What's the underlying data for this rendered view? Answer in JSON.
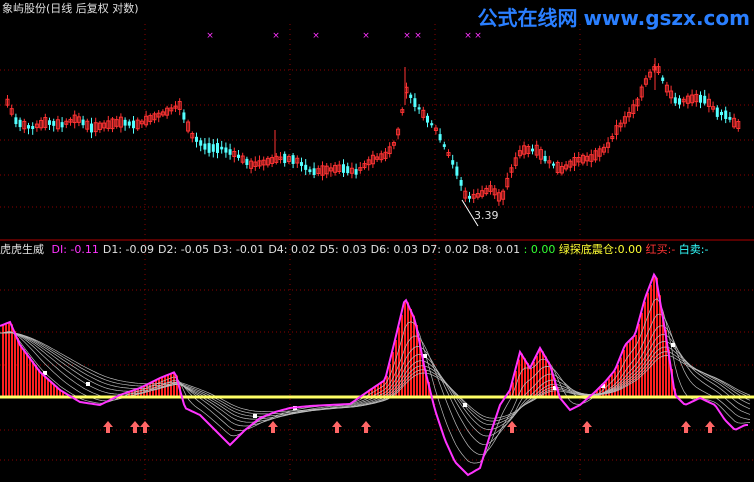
{
  "header": {
    "title": "象屿股份(日线 后复权 对数)",
    "watermark_cn": "公式在线网",
    "watermark_url": "www.gszx.com"
  },
  "indicator": {
    "name": "虎虎生威",
    "items": [
      {
        "label": "DI:",
        "value": "-0.11",
        "color": "#ff33ff"
      },
      {
        "label": "D1:",
        "value": "-0.09",
        "color": "#e0e0e0"
      },
      {
        "label": "D2:",
        "value": "-0.05",
        "color": "#e0e0e0"
      },
      {
        "label": "D3:",
        "value": "-0.01",
        "color": "#e0e0e0"
      },
      {
        "label": "D4:",
        "value": "0.02",
        "color": "#e0e0e0"
      },
      {
        "label": "D5:",
        "value": "0.03",
        "color": "#e0e0e0"
      },
      {
        "label": "D6:",
        "value": "0.03",
        "color": "#e0e0e0"
      },
      {
        "label": "D7:",
        "value": "0.02",
        "color": "#e0e0e0"
      },
      {
        "label": "D8:",
        "value": "0.01",
        "color": "#e0e0e0"
      }
    ],
    "zero_value": ": 0.00",
    "signal_label": "绿探底震仓:",
    "signal_value": "0.00",
    "buy_label": "红买:",
    "buy_value": "-",
    "sell_label": "白卖:",
    "sell_value": "-"
  },
  "price_chart": {
    "low_label": "3.39",
    "colors": {
      "up": "#ff3333",
      "down": "#54ffff",
      "marker": "#ff33ff",
      "grid": "#8b0000"
    }
  },
  "colors": {
    "di_line": "#ff33ff",
    "zero_line": "#ffff66",
    "bars": "#ff2020",
    "arrows": "#ff6666",
    "d_lines": "#bbbbbb"
  }
}
